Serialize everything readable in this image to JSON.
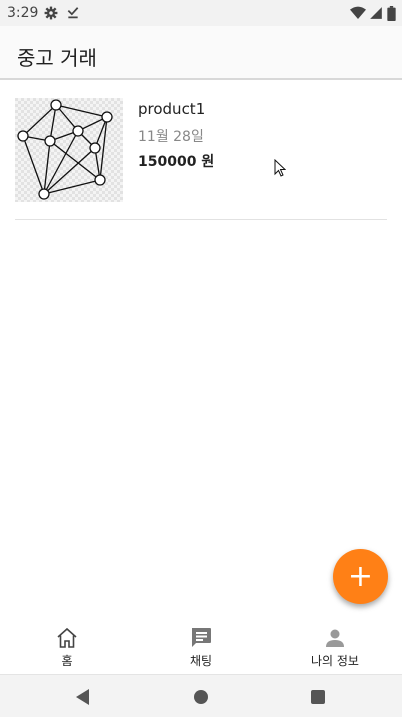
{
  "status_bar": {
    "time": "3:29",
    "left_icons": [
      "gear-icon",
      "download-done-icon"
    ],
    "right_icons": [
      "wifi-icon",
      "signal-icon",
      "battery-icon"
    ]
  },
  "app_bar": {
    "title": "중고 거래"
  },
  "products": [
    {
      "title": "product1",
      "date": "11월 28일",
      "price": "150000 원",
      "thumbnail_icon": "network-graph-icon"
    }
  ],
  "fab": {
    "label": "+",
    "icon": "plus-icon",
    "color": "#ff8016"
  },
  "bottom_nav": [
    {
      "label": "홈",
      "icon": "home-icon"
    },
    {
      "label": "채팅",
      "icon": "chat-icon"
    },
    {
      "label": "나의 정보",
      "icon": "person-icon"
    }
  ],
  "system_nav": {
    "icons": [
      "back-icon",
      "home-circle-icon",
      "recents-icon"
    ]
  }
}
